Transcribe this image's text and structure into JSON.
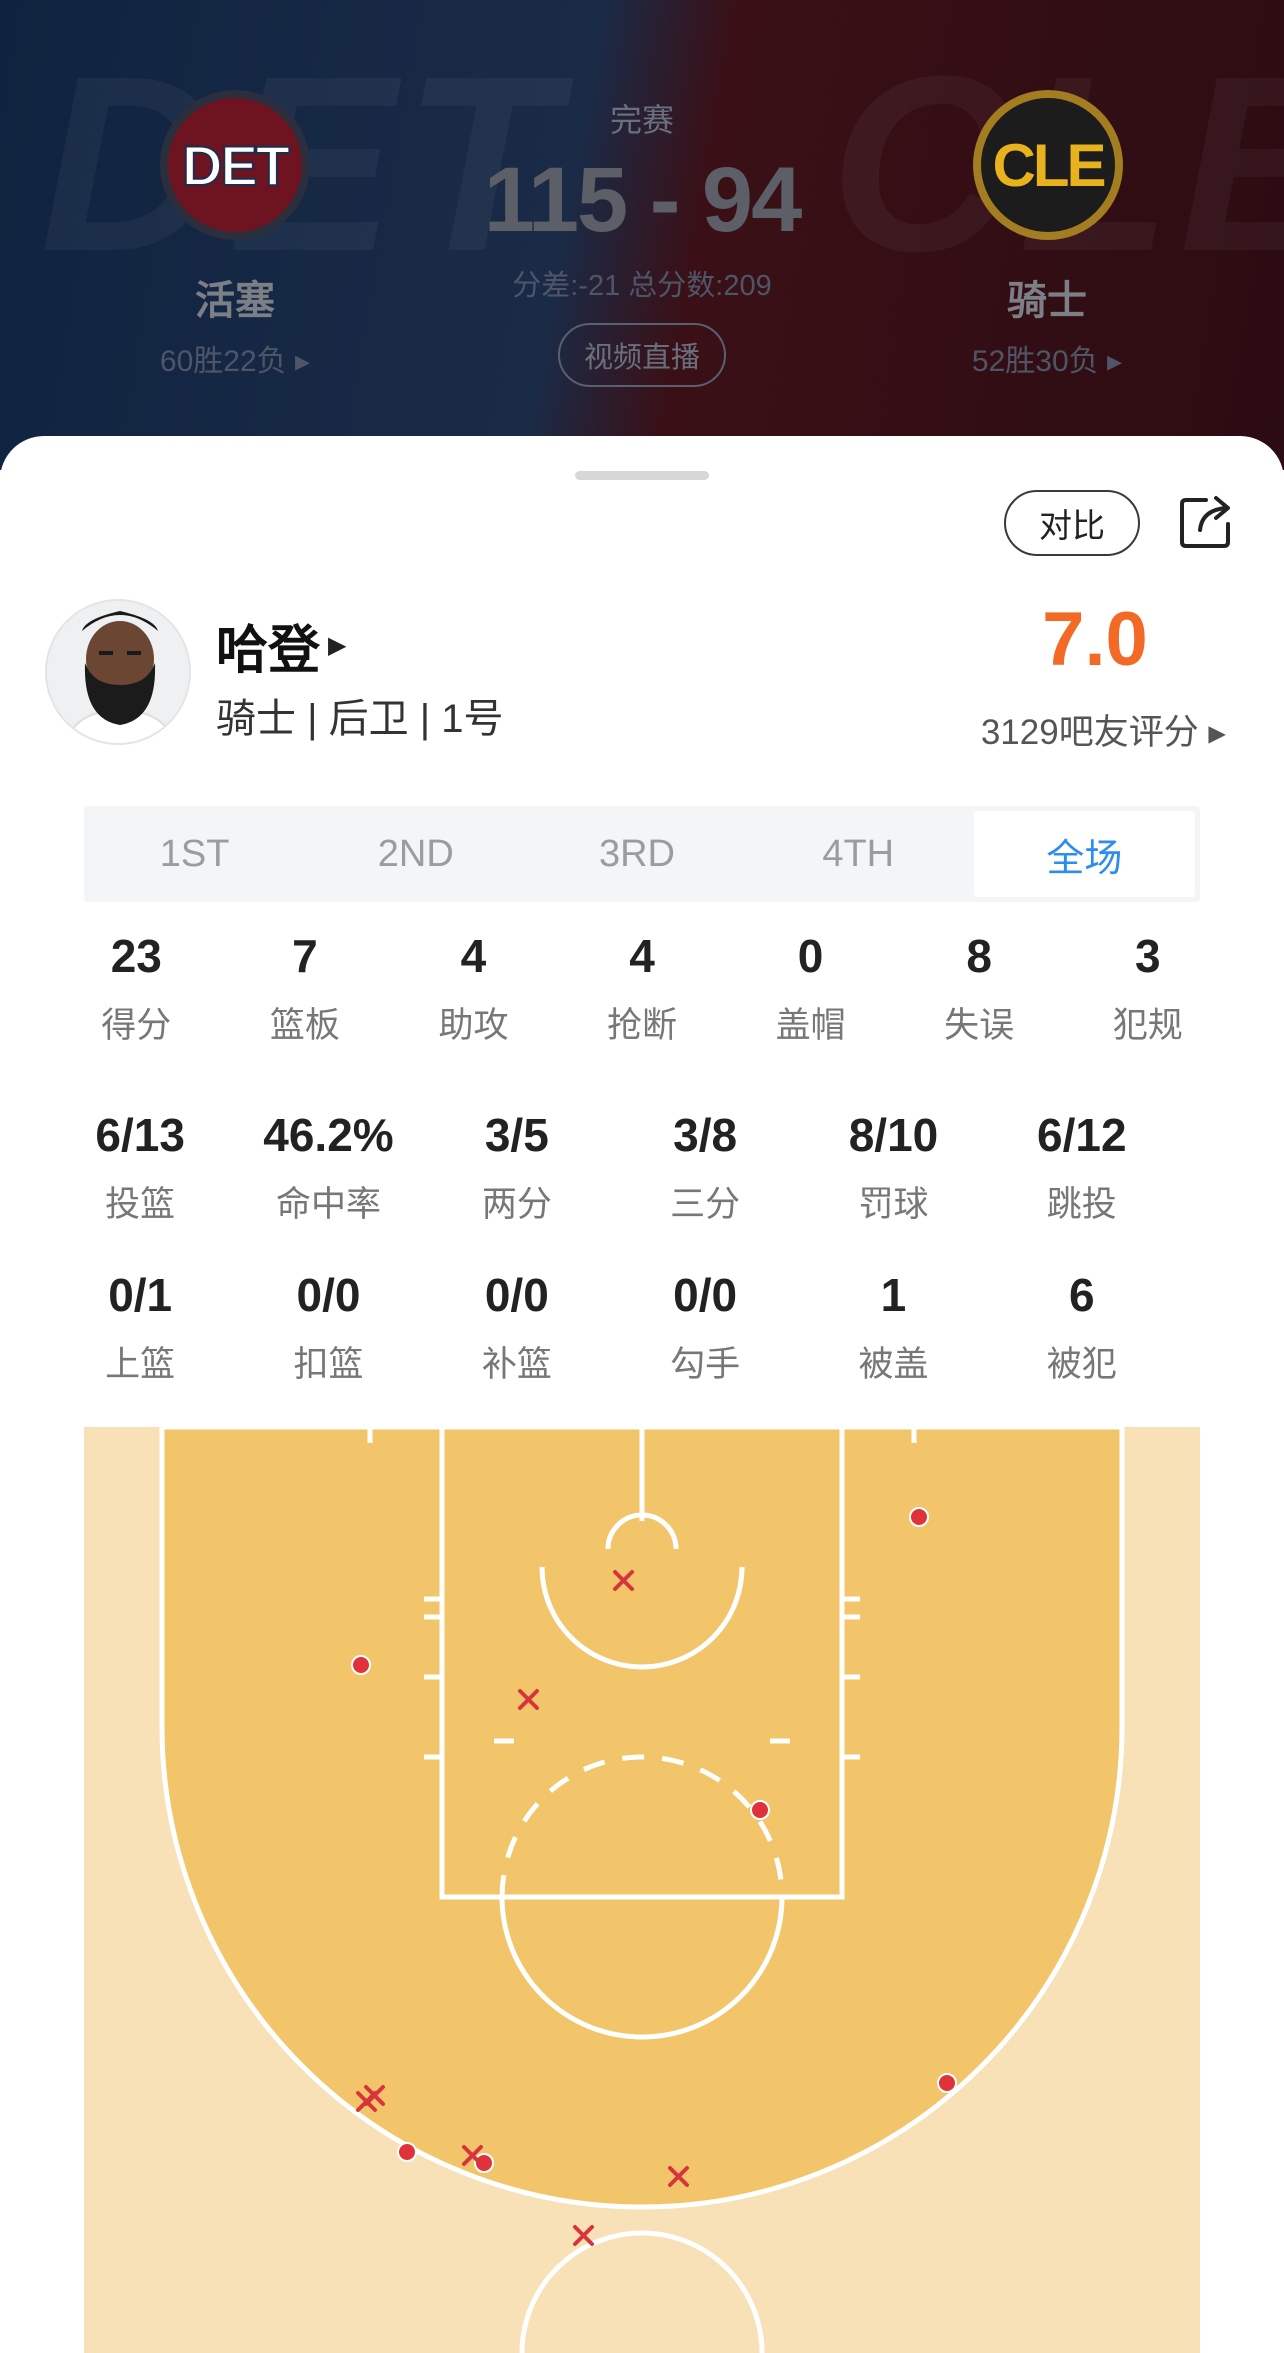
{
  "header": {
    "watermark_left": "DET",
    "watermark_right": "CLE",
    "status": "完赛",
    "score": "115 - 94",
    "score_sub": "分差:-21 总分数:209",
    "video_button": "视频直播",
    "home": {
      "logo_text": "DET",
      "name": "活塞",
      "record": "60胜22负 ▸"
    },
    "away": {
      "logo_text": "CLE",
      "name": "骑士",
      "record": "52胜30负 ▸"
    }
  },
  "toolbar": {
    "compare_label": "对比",
    "share_icon": "share-icon"
  },
  "player": {
    "name": "哈登",
    "meta": "骑士 | 后卫 | 1号",
    "rating": "7.0",
    "rating_count": "3129吧友评分 ▸"
  },
  "tabs": [
    {
      "label": "1ST",
      "active": false
    },
    {
      "label": "2ND",
      "active": false
    },
    {
      "label": "3RD",
      "active": false
    },
    {
      "label": "4TH",
      "active": false
    },
    {
      "label": "全场",
      "active": true
    }
  ],
  "stats_main": [
    {
      "value": "23",
      "label": "得分"
    },
    {
      "value": "7",
      "label": "篮板"
    },
    {
      "value": "4",
      "label": "助攻"
    },
    {
      "value": "4",
      "label": "抢断"
    },
    {
      "value": "0",
      "label": "盖帽"
    },
    {
      "value": "8",
      "label": "失误"
    },
    {
      "value": "3",
      "label": "犯规"
    }
  ],
  "stats_shooting": [
    {
      "value": "6/13",
      "label": "投篮"
    },
    {
      "value": "46.2%",
      "label": "命中率"
    },
    {
      "value": "3/5",
      "label": "两分"
    },
    {
      "value": "3/8",
      "label": "三分"
    },
    {
      "value": "8/10",
      "label": "罚球"
    },
    {
      "value": "6/12",
      "label": "跳投"
    }
  ],
  "stats_other": [
    {
      "value": "0/1",
      "label": "上篮"
    },
    {
      "value": "0/0",
      "label": "扣篮"
    },
    {
      "value": "0/0",
      "label": "补篮"
    },
    {
      "value": "0/0",
      "label": "勾手"
    },
    {
      "value": "1",
      "label": "被盖"
    },
    {
      "value": "6",
      "label": "被犯"
    }
  ],
  "colors": {
    "rating": "#f26a25",
    "tab_active": "#2d8cf0",
    "court_paint": "#f2c56a",
    "court_outer": "#f8e0b7",
    "shot_made": "#e0323a",
    "shot_missed": "#d8343c"
  }
}
